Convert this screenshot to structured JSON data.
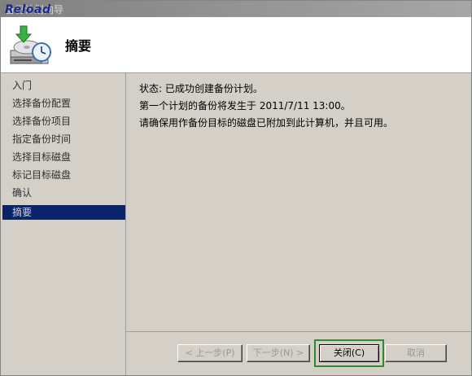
{
  "window": {
    "title": "备份计划向导",
    "brand": "Reload"
  },
  "header": {
    "title": "摘要",
    "icon": "backup-clock-icon"
  },
  "sidebar": {
    "items": [
      {
        "label": "入门",
        "active": false
      },
      {
        "label": "选择备份配置",
        "active": false
      },
      {
        "label": "选择备份项目",
        "active": false
      },
      {
        "label": "指定备份时间",
        "active": false
      },
      {
        "label": "选择目标磁盘",
        "active": false
      },
      {
        "label": "标记目标磁盘",
        "active": false
      },
      {
        "label": "确认",
        "active": false
      },
      {
        "label": "摘要",
        "active": true
      }
    ]
  },
  "content": {
    "status_line": "状态:  已成功创建备份计划。",
    "first_backup_line": "第一个计划的备份将发生于 2011/7/11 13:00。",
    "disk_line": "请确保用作备份目标的磁盘已附加到此计算机，并且可用。"
  },
  "buttons": {
    "prev": "< 上一步(P)",
    "next": "下一步(N) >",
    "close": "关闭(C)",
    "cancel": "取消"
  },
  "colors": {
    "active_step_bg": "#0a246a",
    "focus_ring": "#2d8c2d",
    "dialog_bg": "#d4d0c8"
  }
}
